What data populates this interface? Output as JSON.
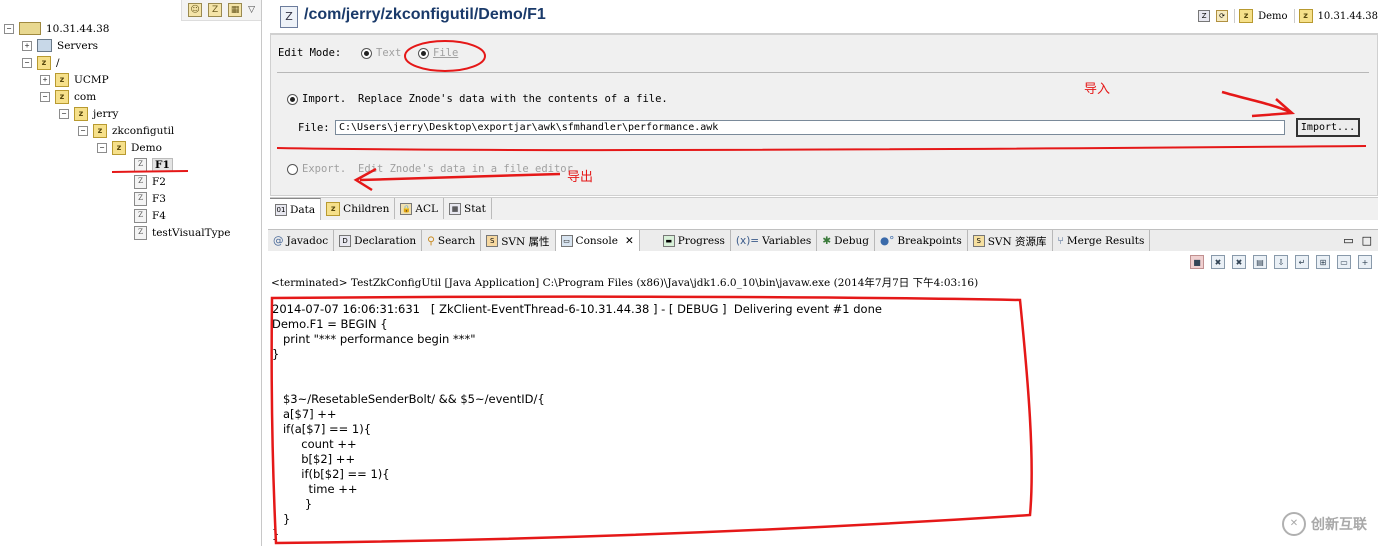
{
  "tree": {
    "toolbar_icons": [
      "users-icon",
      "document-icon",
      "table-icon",
      "menu-arrow-icon"
    ],
    "rows": [
      {
        "label": "10.31.44.38"
      },
      {
        "label": "Servers"
      },
      {
        "label": "/"
      },
      {
        "label": "UCMP"
      },
      {
        "label": "com"
      },
      {
        "label": "jerry"
      },
      {
        "label": "zkconfigutil"
      },
      {
        "label": "Demo"
      },
      {
        "label": "F1"
      },
      {
        "label": "F2"
      },
      {
        "label": "F3"
      },
      {
        "label": "F4"
      },
      {
        "label": "testVisualType"
      }
    ]
  },
  "editor": {
    "title": "/com/jerry/zkconfigutil/Demo/F1",
    "breadcrumbs": [
      {
        "label": "Demo"
      },
      {
        "label": "10.31.44.38"
      }
    ],
    "edit_mode_label": "Edit Mode:",
    "mode_text": "Text",
    "mode_file": "File",
    "import_label": "Import.",
    "import_desc": "Replace Znode's data with the contents of a file.",
    "file_label": "File:",
    "file_value": "C:\\Users\\jerry\\Desktop\\exportjar\\awk\\sfmhandler\\performance.awk",
    "import_button": "Import...",
    "export_label": "Export.",
    "export_desc": "Edit Znode's data in a file editor.",
    "tabs": [
      {
        "label": "Data"
      },
      {
        "label": "Children"
      },
      {
        "label": "ACL"
      },
      {
        "label": "Stat"
      }
    ]
  },
  "annotations": {
    "import_cn": "导入",
    "export_cn": "导出"
  },
  "views": {
    "tabs": [
      {
        "label": "Javadoc"
      },
      {
        "label": "Declaration"
      },
      {
        "label": "Search"
      },
      {
        "label": "SVN 属性"
      },
      {
        "label": "Console"
      },
      {
        "label": "Progress"
      },
      {
        "label": "Variables"
      },
      {
        "label": "Debug"
      },
      {
        "label": "Breakpoints"
      },
      {
        "label": "SVN 资源库"
      },
      {
        "label": "Merge Results"
      }
    ]
  },
  "console": {
    "status": "<terminated> TestZkConfigUtil [Java Application] C:\\Program Files (x86)\\Java\\jdk1.6.0_10\\bin\\javaw.exe (2014年7月7日 下午4:03:16)",
    "output": "2014-07-07 16:06:31:631   [ ZkClient-EventThread-6-10.31.44.38 ] - [ DEBUG ]  Delivering event #1 done\nDemo.F1 = BEGIN {\n   print \"*** performance begin ***\"\n}\n\n\n   $3~/ResetableSenderBolt/ && $5~/eventID/{\n   a[$7] ++\n   if(a[$7] == 1){\n        count ++\n        b[$2] ++\n        if(b[$2] == 1){\n          time ++\n         }\n   }\n}"
  },
  "watermark": {
    "text": "创新互联"
  },
  "colors": {
    "annotation_red": "#e51818",
    "title_blue": "#1a3a6a"
  }
}
